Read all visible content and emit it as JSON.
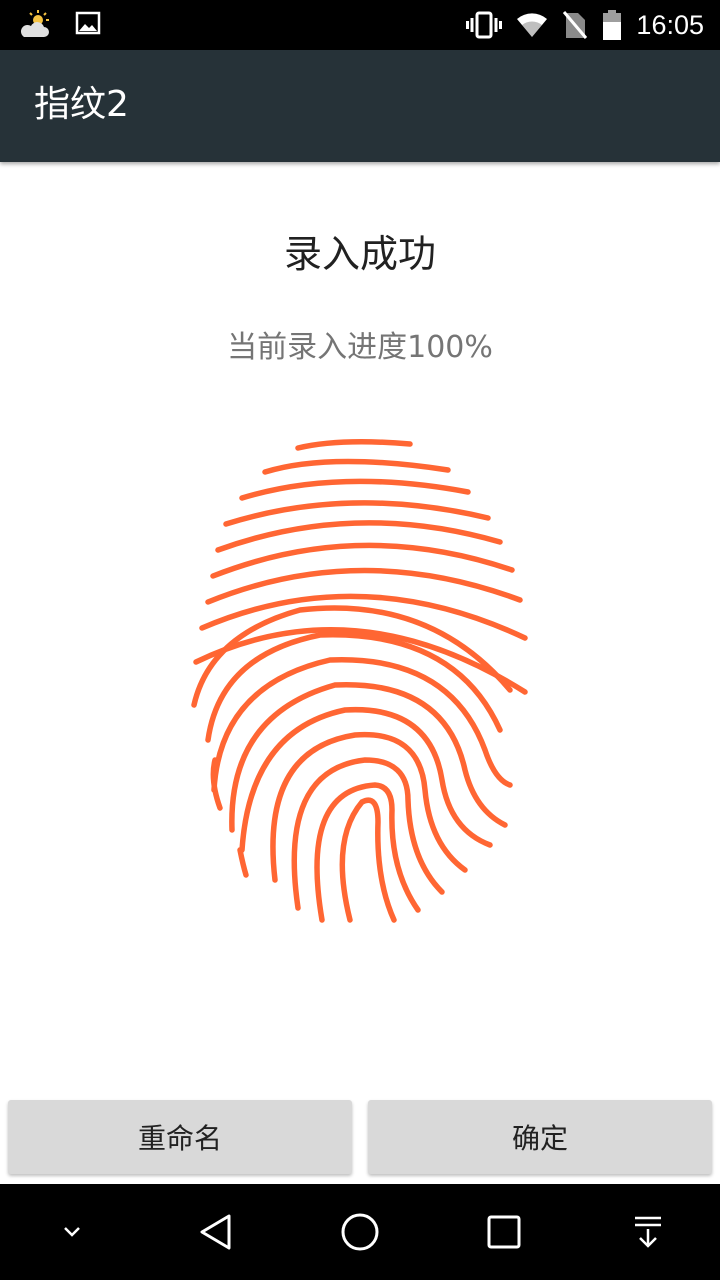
{
  "status_bar": {
    "time": "16:05",
    "left_icons": [
      "weather-icon",
      "image-icon"
    ],
    "right_icons": [
      "vibrate-icon",
      "wifi-icon",
      "no-sim-icon",
      "battery-icon"
    ]
  },
  "app_bar": {
    "title": "指纹2",
    "background": "#263238"
  },
  "enroll": {
    "headline": "录入成功",
    "progress_text": "当前录入进度100%",
    "progress": 1.0,
    "fingerprint_color": "#FF6633"
  },
  "buttons": {
    "rename_label": "重命名",
    "confirm_label": "确定"
  },
  "nav_bar": {
    "icons": [
      "hide-keyboard-icon",
      "back-icon",
      "home-icon",
      "recents-icon",
      "notification-pull-icon"
    ]
  }
}
